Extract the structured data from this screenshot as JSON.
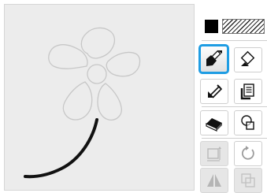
{
  "canvas": {
    "background": "#ececec",
    "outline_color": "#c7c7c7",
    "stroke_color": "#111111"
  },
  "colors": {
    "selection": "#1f9de3",
    "primary": "#000000",
    "pattern_fill": "diagonal-hatch"
  },
  "tools": [
    {
      "name": "brush-tool",
      "icon": "paint-brush-icon",
      "selected": true,
      "enabled": true
    },
    {
      "name": "fill-tool",
      "icon": "paint-bucket-icon",
      "selected": false,
      "enabled": true
    },
    {
      "name": "pen-tool",
      "icon": "pen-icon",
      "selected": false,
      "enabled": true
    },
    {
      "name": "text-tool",
      "icon": "text-page-icon",
      "selected": false,
      "enabled": true
    },
    {
      "name": "eraser-tool",
      "icon": "eraser-icon",
      "selected": false,
      "enabled": true
    },
    {
      "name": "shape-tool",
      "icon": "shapes-icon",
      "selected": false,
      "enabled": true
    },
    {
      "name": "resize-tool",
      "icon": "resize-icon",
      "selected": false,
      "enabled": false
    },
    {
      "name": "rotate-tool",
      "icon": "rotate-icon",
      "selected": false,
      "enabled": true
    },
    {
      "name": "mirror-tool",
      "icon": "mirror-icon",
      "selected": false,
      "enabled": false
    },
    {
      "name": "duplicate-tool",
      "icon": "duplicate-icon",
      "selected": false,
      "enabled": false
    }
  ]
}
